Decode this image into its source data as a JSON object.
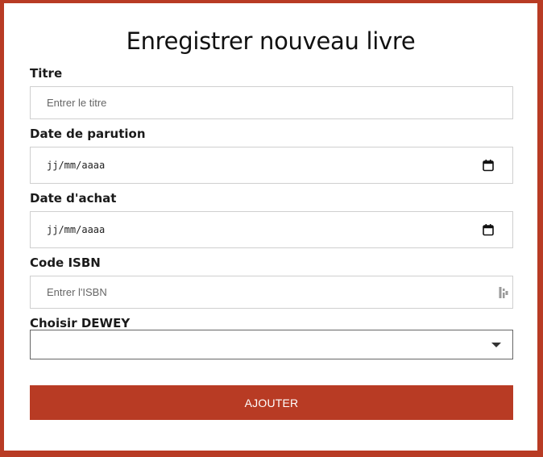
{
  "form": {
    "title": "Enregistrer nouveau livre",
    "fields": {
      "title": {
        "label": "Titre",
        "placeholder": "Entrer le titre",
        "value": ""
      },
      "publication_date": {
        "label": "Date de parution",
        "display": "jj/mm/aaaa",
        "icon": "calendar-icon"
      },
      "purchase_date": {
        "label": "Date d'achat",
        "display": "jj/mm/aaaa",
        "icon": "calendar-icon"
      },
      "isbn": {
        "label": "Code ISBN",
        "placeholder": "Entrer l'ISBN",
        "value": "",
        "icon": "password-manager-key-icon"
      },
      "dewey": {
        "label": "Choisir DEWEY",
        "selected": "",
        "icon": "chevron-down-icon"
      }
    },
    "submit_label": "AJOUTER"
  },
  "colors": {
    "accent": "#b83b24",
    "background": "#ffffff",
    "field_border": "#cfcfcf",
    "text": "#1a1a1a"
  }
}
